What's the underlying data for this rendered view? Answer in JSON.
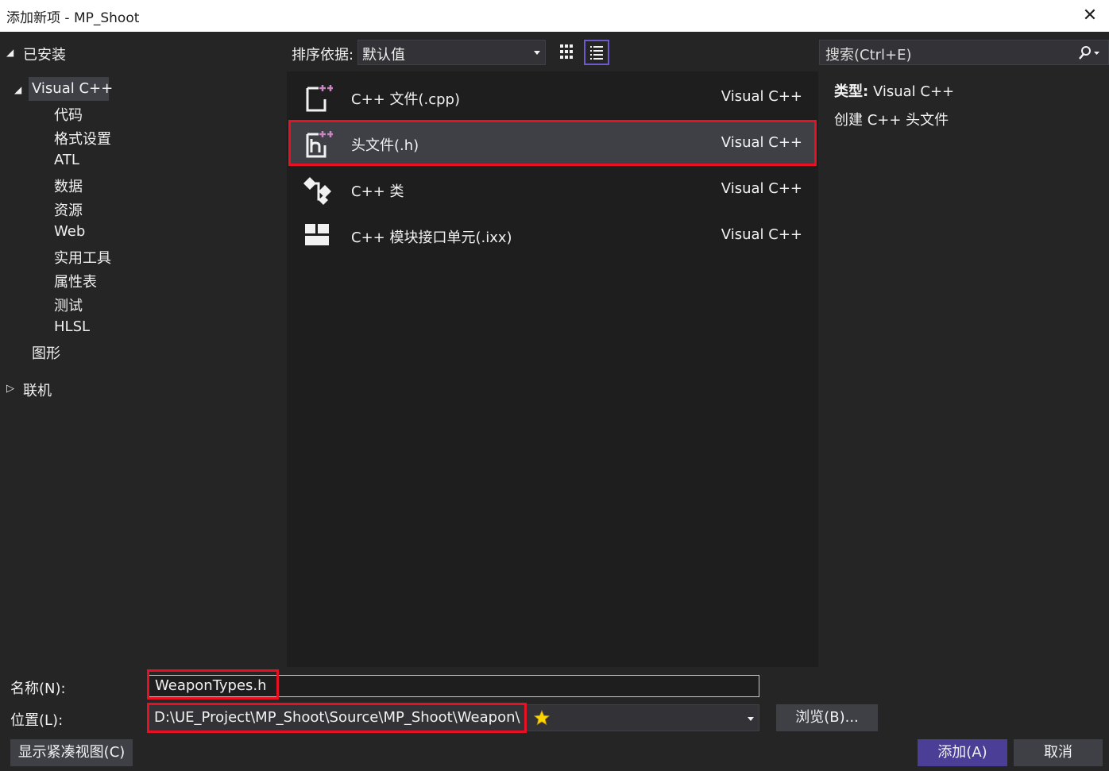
{
  "window": {
    "title": "添加新项 - MP_Shoot",
    "close_glyph": "✕"
  },
  "tree": {
    "installed": "已安装",
    "visual_cpp": "Visual C++",
    "children": [
      "代码",
      "格式设置",
      "ATL",
      "数据",
      "资源",
      "Web",
      "实用工具",
      "属性表",
      "测试",
      "HLSL"
    ],
    "graphics": "图形",
    "online": "联机"
  },
  "toolbar": {
    "sort_label": "排序依据:",
    "sort_value": "默认值"
  },
  "search": {
    "placeholder": "搜索(Ctrl+E)"
  },
  "templates": [
    {
      "name": "C++ 文件(.cpp)",
      "type": "Visual C++",
      "icon": "cpp-file-icon"
    },
    {
      "name": "头文件(.h)",
      "type": "Visual C++",
      "icon": "header-file-icon",
      "selected": true
    },
    {
      "name": "C++ 类",
      "type": "Visual C++",
      "icon": "cpp-class-icon"
    },
    {
      "name": "C++ 模块接口单元(.ixx)",
      "type": "Visual C++",
      "icon": "module-interface-icon"
    }
  ],
  "details": {
    "type_label": "类型:",
    "type_value": "Visual C++",
    "description": "创建 C++ 头文件"
  },
  "form": {
    "name_label": "名称(N):",
    "name_value": "WeaponTypes.h",
    "location_label": "位置(L):",
    "location_value": "D:\\UE_Project\\MP_Shoot\\Source\\MP_Shoot\\Weapon\\",
    "browse_label": "浏览(B)..."
  },
  "buttons": {
    "compact_view": "显示紧凑视图(C)",
    "add": "添加(A)",
    "cancel": "取消"
  },
  "colors": {
    "accent": "#4b3e96",
    "highlight_border": "#e81123",
    "star": "#ffd700",
    "icon_plus": "#c586c0"
  }
}
